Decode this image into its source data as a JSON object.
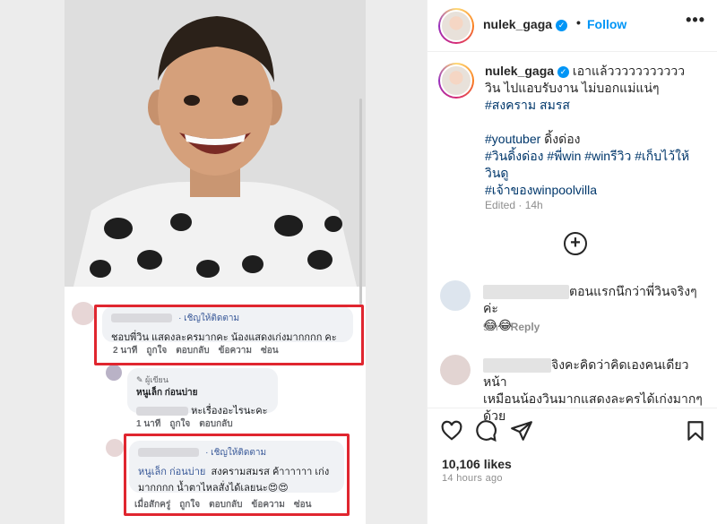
{
  "post": {
    "username": "nulek_gaga",
    "follow_label": "Follow",
    "more_label": "•••",
    "caption_lines": [
      "เอาแล้ววววววววววว วิน ไปแอบรับงาน ไม่บอกแม่แน่ๆ",
      "#สงครามสมรส"
    ],
    "caption_l1": "เอาแล้ววววววววววว วิน",
    "caption_l2": "ไปแอบรับงาน ไม่บอกแม่แน่ๆ ",
    "caption_h1": "#สงคราม",
    "caption_h1b": "สมรส",
    "caption_youtuber": "#youtuber",
    "caption_dingdong": " ดิ้งด่อง",
    "caption_h2": "#วินดิ้งด่อง",
    "caption_h3": "#พี่win",
    "caption_h4": "#winรีวิว",
    "caption_h5": "#เก็บไว้ให้",
    "caption_h5b": "วินดู",
    "caption_h6": "#เจ้าของwinpoolvilla",
    "edited": "Edited · 14h",
    "likes": "10,106 likes",
    "time_ago": "14 hours ago"
  },
  "comments": [
    {
      "text": "ตอนแรกนึกว่าพี่วินจริงๆค่ะ",
      "emoji": "😂😂",
      "time": "9m",
      "reply": "Reply"
    },
    {
      "text_l1": "จิงคะคิดว่าคิดเองคนเดียวหน้า",
      "text_l2": "เหมือนน้องวินมากแสดงละครได้เก่งมากๆ",
      "text_l3": "ด้วย"
    }
  ],
  "fb_screenshot": {
    "follow_invite": "· เชิญให้ติดตาม",
    "c1_text": "ชอบพี่วิน แสดงละครมากคะ น้องแสดงเก่งมากกกก คะ",
    "c1_meta": [
      "2 นาที",
      "ถูกใจ",
      "ตอบกลับ",
      "ข้อความ",
      "ซ่อน"
    ],
    "author_tag": "ผู้เขียน",
    "author_name": "หนูเล็ก ก่อนบ่าย",
    "c2_text": "หะเรื่องอะไรนะคะ",
    "c2_meta": [
      "1 นาที",
      "ถูกใจ",
      "ตอบกลับ"
    ],
    "c3_name": "หนูเล็ก ก่อนบ่าย",
    "c3_text_a": "สงครามสมรส ค้าาาาาา เก่ง",
    "c3_text_b": "มากกกก น้ำตาไหลสั่งได้เลยนะ😍😍",
    "c3_meta": [
      "เมื่อสักครู่",
      "ถูกใจ",
      "ตอบกลับ",
      "ข้อความ",
      "ซ่อน"
    ]
  },
  "colors": {
    "accent": "#0095f6",
    "highlight_box": "#e0262f",
    "hashtag": "#00376b"
  },
  "icons": [
    "verified-badge-icon",
    "more-options-icon",
    "add-comment-icon",
    "heart-icon",
    "comment-icon",
    "share-icon",
    "bookmark-icon"
  ]
}
